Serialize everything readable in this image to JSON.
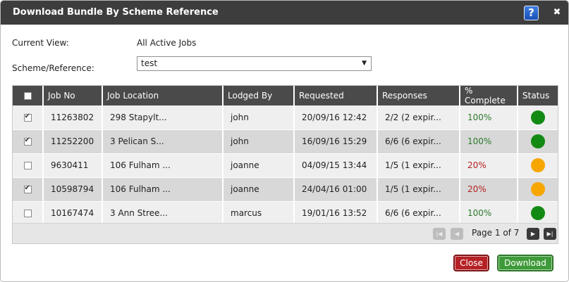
{
  "dialog": {
    "title": "Download Bundle By Scheme Reference",
    "help_label": "?",
    "close_label": "✖"
  },
  "form": {
    "current_view_label": "Current View:",
    "current_view_value": "All Active Jobs",
    "scheme_label": "Scheme/Reference:",
    "scheme_value": "test"
  },
  "table": {
    "columns": [
      "Job No",
      "Job Location",
      "Lodged By",
      "Requested",
      "Responses",
      "% Complete",
      "Status"
    ],
    "rows": [
      {
        "checked": true,
        "job_no": "11263802",
        "location": "298 Stapylt...",
        "lodged_by": "john",
        "requested": "20/09/16 12:42",
        "responses": "2/2 (2 expir...",
        "complete": "100%",
        "status_color": "#138a13"
      },
      {
        "checked": true,
        "job_no": "11252200",
        "location": "3 Pelican S...",
        "lodged_by": "john",
        "requested": "16/09/16 15:29",
        "responses": "6/6 (6 expir...",
        "complete": "100%",
        "status_color": "#138a13"
      },
      {
        "checked": false,
        "job_no": "9630411",
        "location": "106 Fulham ...",
        "lodged_by": "joanne",
        "requested": "04/09/15 13:44",
        "responses": "1/5 (1 expir...",
        "complete": "20%",
        "status_color": "#f7a600"
      },
      {
        "checked": true,
        "job_no": "10598794",
        "location": "106 Fulham ...",
        "lodged_by": "joanne",
        "requested": "24/04/16 01:00",
        "responses": "1/5 (1 expir...",
        "complete": "20%",
        "status_color": "#f7a600"
      },
      {
        "checked": false,
        "job_no": "10167474",
        "location": "3 Ann Stree...",
        "lodged_by": "marcus",
        "requested": "19/01/16 13:52",
        "responses": "6/6 (6 expir...",
        "complete": "100%",
        "status_color": "#138a13"
      }
    ]
  },
  "pager": {
    "text": "Page 1 of 7",
    "first_icon": "first-page-icon",
    "prev_icon": "prev-page-icon",
    "next_icon": "next-page-icon",
    "last_icon": "last-page-icon"
  },
  "buttons": {
    "close_label": "Close",
    "download_label": "Download"
  },
  "colors": {
    "titlebar": "#3d3d3d",
    "close_button": "#b52226",
    "download_button": "#3f9a3a",
    "status_green": "#138a13",
    "status_amber": "#f7a600"
  }
}
